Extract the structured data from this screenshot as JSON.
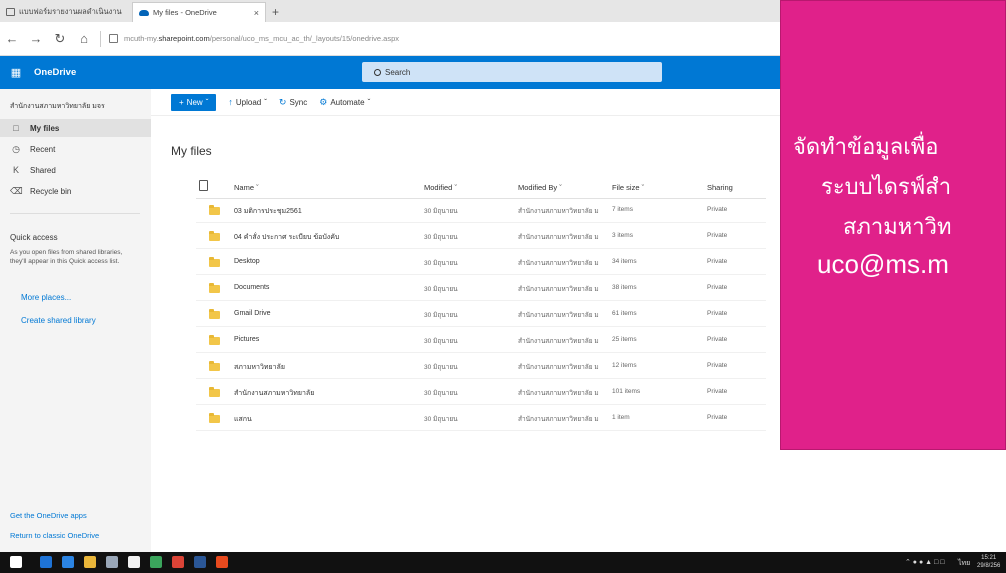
{
  "browser": {
    "tabs": [
      {
        "label": "แบบฟอร์มรายงานผลดำเนินงาน",
        "active": false
      },
      {
        "label": "My files - OneDrive",
        "active": true
      }
    ],
    "new_tab": "+",
    "tab_close": "×",
    "url_prefix": "mcuth-my.",
    "url_domain": "sharepoint.com",
    "url_path": "/personal/uco_ms_mcu_ac_th/_layouts/15/onedrive.aspx"
  },
  "suite": {
    "app_name": "OneDrive",
    "search_placeholder": "Search"
  },
  "leftnav": {
    "owner": "สำนักงานสภามหาวิทยาลัย มจร",
    "items": [
      {
        "label": "My files",
        "icon": "folder-icon",
        "selected": true
      },
      {
        "label": "Recent",
        "icon": "clock-icon",
        "selected": false
      },
      {
        "label": "Shared",
        "icon": "people-icon",
        "selected": false
      },
      {
        "label": "Recycle bin",
        "icon": "trash-icon",
        "selected": false
      }
    ],
    "quick_access_title": "Quick access",
    "quick_access_desc": "As you open files from shared libraries, they'll appear in this Quick access list.",
    "more_places": "More places...",
    "create_shared_library": "Create shared library",
    "get_apps": "Get the OneDrive apps",
    "return_classic": "Return to classic OneDrive"
  },
  "commands": {
    "new": "New",
    "upload": "Upload",
    "sync": "Sync",
    "automate": "Automate"
  },
  "main": {
    "title": "My files",
    "columns": {
      "name": "Name",
      "modified": "Modified",
      "modified_by": "Modified By",
      "file_size": "File size",
      "sharing": "Sharing"
    },
    "rows": [
      {
        "name": "03 มติการประชุม2561",
        "modified": "30 มิถุนายน",
        "by": "สำนักงานสภามหาวิทยาลัย ม",
        "size": "7 items",
        "sharing": "Private"
      },
      {
        "name": "04 คำสั่ง ประกาศ ระเบียบ ข้อบังคับ",
        "modified": "30 มิถุนายน",
        "by": "สำนักงานสภามหาวิทยาลัย ม",
        "size": "3 items",
        "sharing": "Private"
      },
      {
        "name": "Desktop",
        "modified": "30 มิถุนายน",
        "by": "สำนักงานสภามหาวิทยาลัย ม",
        "size": "34 items",
        "sharing": "Private"
      },
      {
        "name": "Documents",
        "modified": "30 มิถุนายน",
        "by": "สำนักงานสภามหาวิทยาลัย ม",
        "size": "38 items",
        "sharing": "Private"
      },
      {
        "name": "Gmail Drive",
        "modified": "30 มิถุนายน",
        "by": "สำนักงานสภามหาวิทยาลัย ม",
        "size": "61 items",
        "sharing": "Private"
      },
      {
        "name": "Pictures",
        "modified": "30 มิถุนายน",
        "by": "สำนักงานสภามหาวิทยาลัย ม",
        "size": "25 items",
        "sharing": "Private"
      },
      {
        "name": "สภามหาวิทยาลัย",
        "modified": "30 มิถุนายน",
        "by": "สำนักงานสภามหาวิทยาลัย ม",
        "size": "12 items",
        "sharing": "Private"
      },
      {
        "name": "สำนักงานสภามหาวิทยาลัย",
        "modified": "30 มิถุนายน",
        "by": "สำนักงานสภามหาวิทยาลัย ม",
        "size": "101 items",
        "sharing": "Private"
      },
      {
        "name": "แสกน",
        "modified": "30 มิถุนายน",
        "by": "สำนักงานสภามหาวิทยาลัย ม",
        "size": "1 item",
        "sharing": "Private"
      }
    ]
  },
  "overlay": {
    "line1": "จัดทำข้อมูลเพื่อ",
    "line2": "ระบบไดรฟ์สำ",
    "line3": "สภามหาวิท",
    "line4": "uco@ms.m",
    "color": "#e0218a"
  },
  "taskbar": {
    "tray": "ไทย",
    "time": "15:21",
    "date": "29/8/256"
  },
  "colors": {
    "suite_blue": "#0078d4",
    "folder_yellow": "#f2c649"
  }
}
